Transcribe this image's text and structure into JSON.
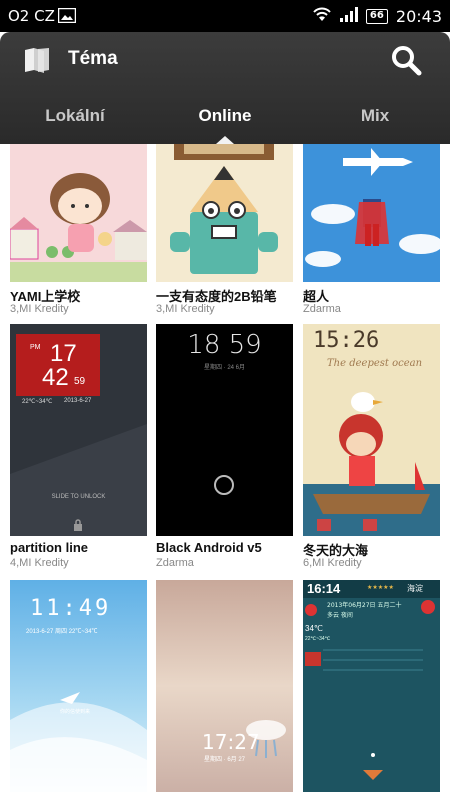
{
  "status_bar": {
    "carrier": "O2 CZ",
    "battery": "66",
    "time": "20:43"
  },
  "header": {
    "title": "Téma",
    "tabs": [
      {
        "label": "Lokální",
        "active": false
      },
      {
        "label": "Online",
        "active": true
      },
      {
        "label": "Mix",
        "active": false
      }
    ]
  },
  "themes": [
    {
      "name": "YAMI上学校",
      "price": "3,MI Kredity"
    },
    {
      "name": "一支有态度的2B铅笔",
      "price": "3,MI Kredity"
    },
    {
      "name": "超人",
      "price": "Zdarma"
    },
    {
      "name": "partition  line",
      "price": "4,MI Kredity",
      "preview": {
        "hour": "17",
        "minute": "42",
        "seconds": "59",
        "pm": "PM",
        "temp": "22℃~34℃",
        "date": "2013-6-27",
        "unlock": "SLIDE TO UNLOCK"
      }
    },
    {
      "name": "Black Android v5",
      "price": "Zdarma",
      "preview": {
        "time": "18 59",
        "date": "星期四 · 24 6月"
      }
    },
    {
      "name": "冬天的大海",
      "price": "6,MI Kredity",
      "preview": {
        "time": "15:26",
        "caption": "The deepest ocean"
      }
    },
    {
      "name": "",
      "price": "",
      "preview": {
        "time": "11:49",
        "date": "2013-6-27 周四 22℃~34℃",
        "caption": "你的信使到来"
      }
    },
    {
      "name": "",
      "price": "",
      "preview": {
        "time": "17:27",
        "date": "星期四 · 6月 27"
      }
    },
    {
      "name": "",
      "price": "",
      "preview": {
        "time": "16:14",
        "stars": "★★★★★",
        "city": "海淀",
        "date": "2013年06月27日 五月二十",
        "weather": "多云 夜间",
        "temp": "34℃",
        "range": "22℃~34℃"
      }
    }
  ],
  "colors": {
    "header": "#333333",
    "accent": "#ffffff"
  }
}
